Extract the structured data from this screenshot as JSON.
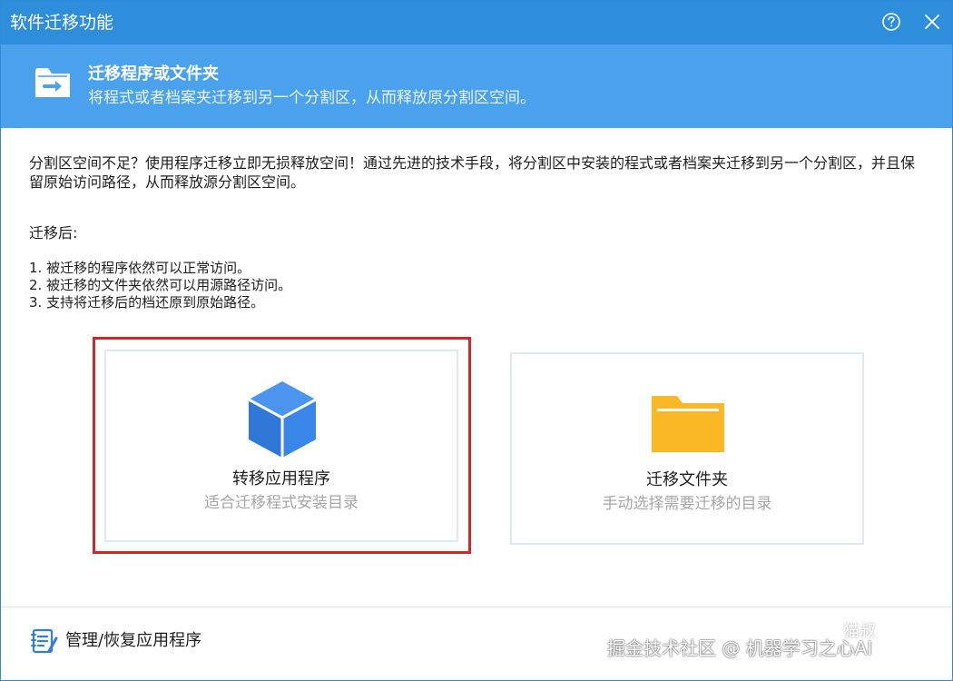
{
  "window": {
    "title": "软件迁移功能"
  },
  "banner": {
    "title": "迁移程序或文件夹",
    "subtitle": "将程式或者档案夹迁移到另一个分割区，从而释放原分割区空间。"
  },
  "main": {
    "intro": "分割区空间不足？使用程序迁移立即无损释放空间！通过先进的技术手段，将分割区中安装的程式或者档案夹迁移到另一个分割区，并且保留原始访问路径，从而释放源分割区空间。",
    "after_label": "迁移后:",
    "points": [
      "1. 被迁移的程序依然可以正常访问。",
      "2. 被迁移的文件夹依然可以用源路径访问。",
      "3. 支持将迁移后的档还原到原始路径。"
    ]
  },
  "cards": {
    "app": {
      "title": "转移应用程序",
      "subtitle": "适合迁移程式安装目录",
      "icon": "cube-icon"
    },
    "folder": {
      "title": "迁移文件夹",
      "subtitle": "手动选择需要迁移的目录",
      "icon": "folder-icon"
    }
  },
  "footer": {
    "manage_label": "管理/恢复应用程序",
    "watermark": "掘金技术社区 @ 机器学习之心AI",
    "watermark_sub": "猫叔"
  },
  "colors": {
    "titlebar": "#2f8edc",
    "banner": "#4aa1ec",
    "highlight": "#cc2a2a",
    "cube": "#3a86e8",
    "folder": "#fbb826"
  }
}
